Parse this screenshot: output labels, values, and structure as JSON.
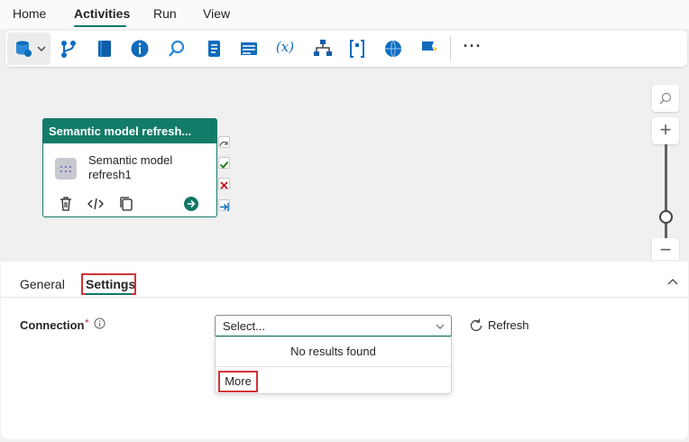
{
  "menu": {
    "items": [
      {
        "label": "Home"
      },
      {
        "label": "Activities"
      },
      {
        "label": "Run"
      },
      {
        "label": "View"
      }
    ],
    "active": "Activities"
  },
  "toolbar": {
    "icons": [
      "data-store-icon",
      "branch-icon",
      "notebook-icon",
      "info-icon",
      "search-icon",
      "script-icon",
      "form-icon",
      "variable-icon",
      "hierarchy-icon",
      "bracket-icon",
      "globe-icon",
      "flag-icon"
    ],
    "more_label": "···",
    "variable_label": "(x)"
  },
  "canvas": {
    "node": {
      "header": "Semantic model refresh...",
      "label": "Semantic model refresh1",
      "actions": [
        "delete-icon",
        "code-icon",
        "copy-icon",
        "go-icon"
      ]
    },
    "ports": [
      "skip-port",
      "success-port",
      "fail-port",
      "complete-port"
    ]
  },
  "panel": {
    "tabs": [
      {
        "label": "General"
      },
      {
        "label": "Settings"
      }
    ],
    "active_tab": "Settings",
    "connection": {
      "label": "Connection",
      "required_mark": "*",
      "select_placeholder": "Select...",
      "refresh_label": "Refresh",
      "dropdown": {
        "empty_text": "No results found",
        "more_label": "More"
      }
    }
  },
  "colors": {
    "accent": "#117865",
    "highlight": "#d13438"
  }
}
